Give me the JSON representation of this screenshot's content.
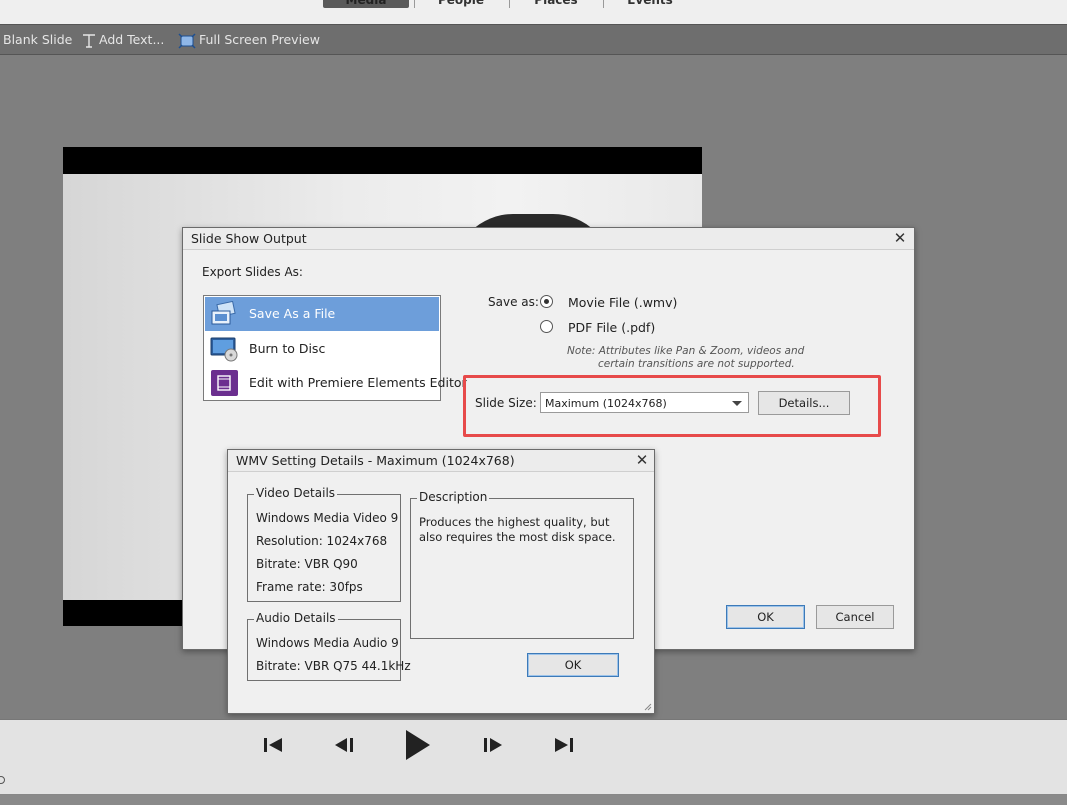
{
  "top_tabs": [
    "Media",
    "People",
    "Places",
    "Events"
  ],
  "toolbar": {
    "blank_slide": "Blank Slide",
    "add_text": "Add Text...",
    "full_screen_preview": "Full Screen Preview"
  },
  "output_dialog": {
    "title": "Slide Show Output",
    "export_label": "Export Slides As:",
    "export_options": [
      {
        "label": "Save As a File",
        "icon": "save-file-icon",
        "selected": true
      },
      {
        "label": "Burn to Disc",
        "icon": "burn-disc-icon",
        "selected": false
      },
      {
        "label": "Edit with Premiere Elements Editor",
        "icon": "premiere-film-icon",
        "selected": false
      }
    ],
    "save_as_label": "Save as:",
    "save_options": [
      {
        "label": "Movie File (.wmv)",
        "checked": true
      },
      {
        "label": "PDF File (.pdf)",
        "checked": false
      }
    ],
    "note_line1": "Note:  Attributes like Pan & Zoom, videos and",
    "note_line2": "certain transitions are not supported.",
    "slide_size_label": "Slide Size:",
    "slide_size_value": "Maximum (1024x768)",
    "details_button": "Details...",
    "ok_button": "OK",
    "cancel_button": "Cancel",
    "highlight_color": "#e74a4a"
  },
  "wmv_dialog": {
    "title": "WMV Setting Details - Maximum (1024x768)",
    "video_group_title": "Video Details",
    "video_lines": [
      "Windows Media Video 9",
      "Resolution: 1024x768",
      "Bitrate: VBR Q90",
      "Frame rate: 30fps"
    ],
    "audio_group_title": "Audio Details",
    "audio_lines": [
      "Windows Media Audio 9",
      "Bitrate: VBR Q75 44.1kHz"
    ],
    "description_title": "Description",
    "description_text": "Produces the highest quality, but also requires the most disk space.",
    "ok_button": "OK"
  },
  "playback": {
    "buttons": [
      "skip-to-start-icon",
      "previous-frame-icon",
      "play-icon",
      "next-frame-icon",
      "skip-to-end-icon"
    ]
  }
}
